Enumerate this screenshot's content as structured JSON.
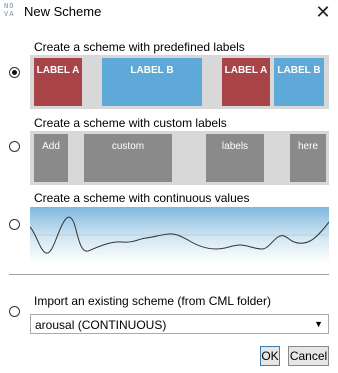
{
  "window": {
    "logo_text": "NOVA",
    "title": "New Scheme",
    "close_glyph": "✕"
  },
  "options": {
    "predefined": {
      "label": "Create a scheme with predefined labels",
      "selected": true,
      "labels": [
        "LABEL A",
        "LABEL B",
        "LABEL A",
        "LABEL B"
      ],
      "colors": [
        "#a84448",
        "#5fa9d8",
        "#a84448",
        "#5fa9d8"
      ]
    },
    "custom": {
      "label": "Create a scheme with custom labels",
      "selected": false,
      "labels": [
        "Add",
        "custom",
        "labels",
        "here"
      ]
    },
    "continuous": {
      "label": "Create a scheme with continuous values",
      "selected": false
    },
    "import": {
      "label": "Import an existing scheme (from CML folder)",
      "selected": false,
      "combo_value": "arousal (CONTINUOUS)",
      "combo_arrow": "▼"
    }
  },
  "buttons": {
    "ok": "OK",
    "cancel": "Cancel"
  }
}
